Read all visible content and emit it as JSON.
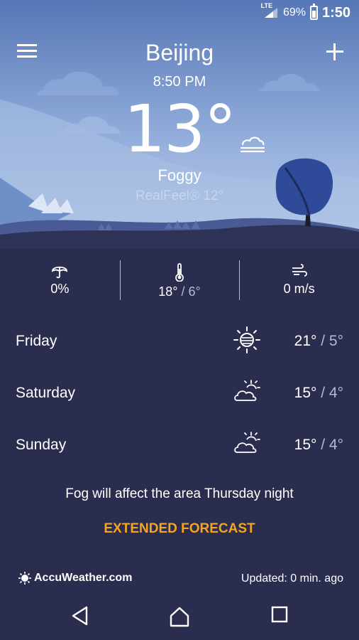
{
  "status": {
    "network": "LTE",
    "battery": "69%",
    "battery_level": 0.69,
    "time": "1:50"
  },
  "header": {
    "city": "Beijing",
    "local_time": "8:50 PM"
  },
  "current": {
    "temperature": "13",
    "unit": "°",
    "condition": "Foggy",
    "realfeel": "RealFeel® 12°",
    "condition_icon": "fog-cloud-icon"
  },
  "stats": {
    "precip": {
      "icon": "umbrella-icon",
      "value": "0%"
    },
    "temp": {
      "icon": "thermometer-icon",
      "high": "18°",
      "sep": " / ",
      "low": "6°"
    },
    "wind": {
      "icon": "wind-icon",
      "value": "0 m/s"
    }
  },
  "forecast": [
    {
      "day": "Friday",
      "icon": "sun-icon",
      "high": "21°",
      "low": "5°"
    },
    {
      "day": "Saturday",
      "icon": "partly-cloudy-icon",
      "high": "15°",
      "low": "4°"
    },
    {
      "day": "Sunday",
      "icon": "partly-cloudy-icon",
      "high": "15°",
      "low": "4°"
    }
  ],
  "alert": "Fog will affect the area Thursday night",
  "extended_label": "EXTENDED FORECAST",
  "footer": {
    "brand": "AccuWeather.com",
    "updated": "Updated: 0 min. ago"
  },
  "colors": {
    "accent": "#f5a423",
    "panel": "#2a2d4e",
    "sky_top": "#5779b8",
    "sky_bottom": "#b8cbe9"
  }
}
